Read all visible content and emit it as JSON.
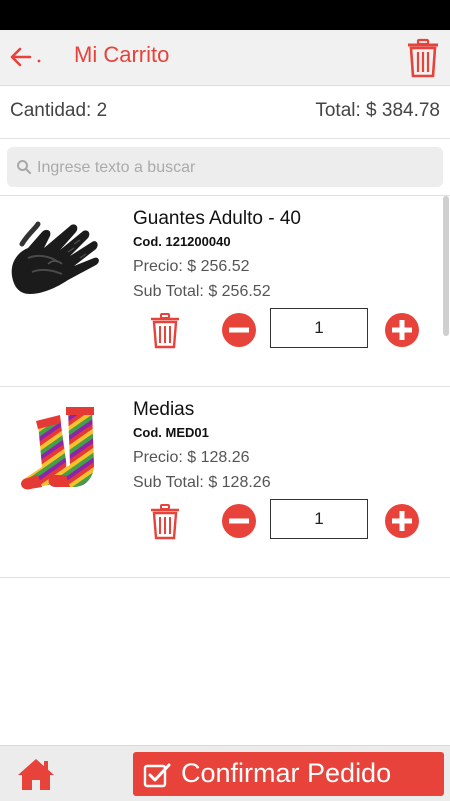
{
  "header": {
    "title": "Mi Carrito",
    "back_icon": "arrow-left-icon",
    "delete_all_icon": "trash-icon",
    "accent": "#e7433a"
  },
  "summary": {
    "quantity": "Cantidad: 2",
    "total": "Total: $ 384.78"
  },
  "search": {
    "placeholder": "Ingrese texto a buscar",
    "value": ""
  },
  "items": [
    {
      "name": "Guantes Adulto - 40",
      "code": "Cod. 121200040",
      "price": "Precio: $ 256.52",
      "subtotal": "Sub Total: $ 256.52",
      "quantity": "1",
      "image": "black-gloves"
    },
    {
      "name": "Medias",
      "code": "Cod. MED01",
      "price": "Precio: $ 128.26",
      "subtotal": "Sub Total: $ 128.26",
      "quantity": "1",
      "image": "striped-socks"
    }
  ],
  "footer": {
    "home_icon": "home-icon",
    "confirm_label": "Confirmar Pedido",
    "confirm_icon": "checkbox-icon"
  }
}
